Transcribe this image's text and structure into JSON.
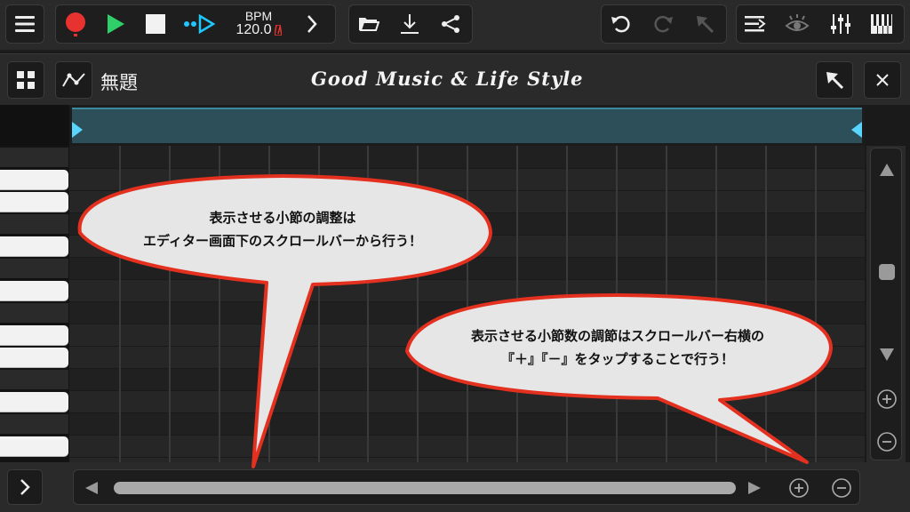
{
  "toolbar": {
    "bpm_label": "BPM",
    "bpm_value": "120.0",
    "record_color": "#e8322f",
    "play_color": "#2fd06a",
    "accent_blue": "#1ec8ff",
    "icons": [
      "menu-icon",
      "record-icon",
      "play-icon",
      "stop-icon",
      "step-icon",
      "chevron-right-icon",
      "folder-icon",
      "download-icon",
      "share-icon",
      "undo-icon",
      "redo-icon",
      "pointer-icon",
      "list-icon",
      "eye-icon",
      "mixer-icon",
      "piano-icon"
    ]
  },
  "titlebar": {
    "track_title": "無題",
    "tagline": "Good Music & Life Style"
  },
  "callouts": {
    "left_line1": "表示させる小節の調整は",
    "left_line2": "エディター画面下のスクロールバーから行う！",
    "right_line1": "表示させる小節数の調節はスクロールバー右横の",
    "right_line2": "『＋』『－』をタップすることで行う！"
  },
  "colors": {
    "callout_border": "#e3301f",
    "callout_fill": "#e6e6e6",
    "ruler_range": "#2c4f5a",
    "ruler_marker": "#58d6ff"
  }
}
